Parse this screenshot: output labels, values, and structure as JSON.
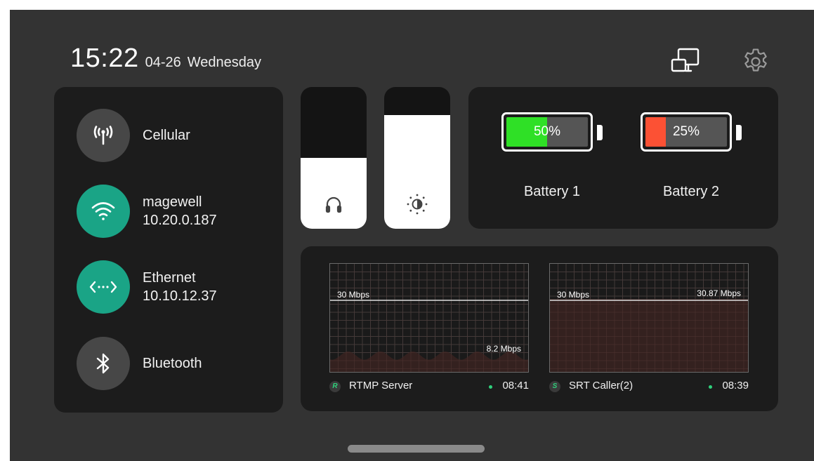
{
  "header": {
    "time": "15:22",
    "date": "04-26",
    "weekday": "Wednesday",
    "icons": [
      "screen-cast-icon",
      "gear-icon"
    ]
  },
  "network": {
    "items": [
      {
        "label": "Cellular",
        "detail": "",
        "icon": "cellular-antenna-icon",
        "active": false
      },
      {
        "label": "magewell",
        "detail": "10.20.0.187",
        "icon": "wifi-icon",
        "active": true
      },
      {
        "label": "Ethernet",
        "detail": "10.10.12.37",
        "icon": "ethernet-icon",
        "active": true
      },
      {
        "label": "Bluetooth",
        "detail": "",
        "icon": "bluetooth-icon",
        "active": false
      }
    ]
  },
  "controls": {
    "volume_level": 0.5,
    "volume_icon": "headphones-icon",
    "brightness_level": 0.8,
    "brightness_icon": "brightness-icon"
  },
  "batteries": [
    {
      "label": "Battery 1",
      "percent_text": "50%",
      "level": 0.5,
      "color": "#2fe026"
    },
    {
      "label": "Battery 2",
      "percent_text": "25%",
      "level": 0.25,
      "color": "#fc5134"
    }
  ],
  "streams": [
    {
      "name": "RTMP Server",
      "badge": "R",
      "time": "08:41",
      "max_label": "30 Mbps",
      "current_label": "8.2 Mbps",
      "max_value": 30,
      "current_value": 8.2,
      "profile": "wave"
    },
    {
      "name": "SRT Caller(2)",
      "badge": "S",
      "time": "08:39",
      "max_label": "30 Mbps",
      "current_label": "30.87 Mbps",
      "max_value": 30,
      "current_value": 30.87,
      "profile": "flat"
    }
  ],
  "colors": {
    "background": "#333333",
    "panel": "#1c1c1c",
    "accent_green": "#1aa486",
    "status_green": "#2fd07b",
    "graph_fill": "#3a2321"
  }
}
